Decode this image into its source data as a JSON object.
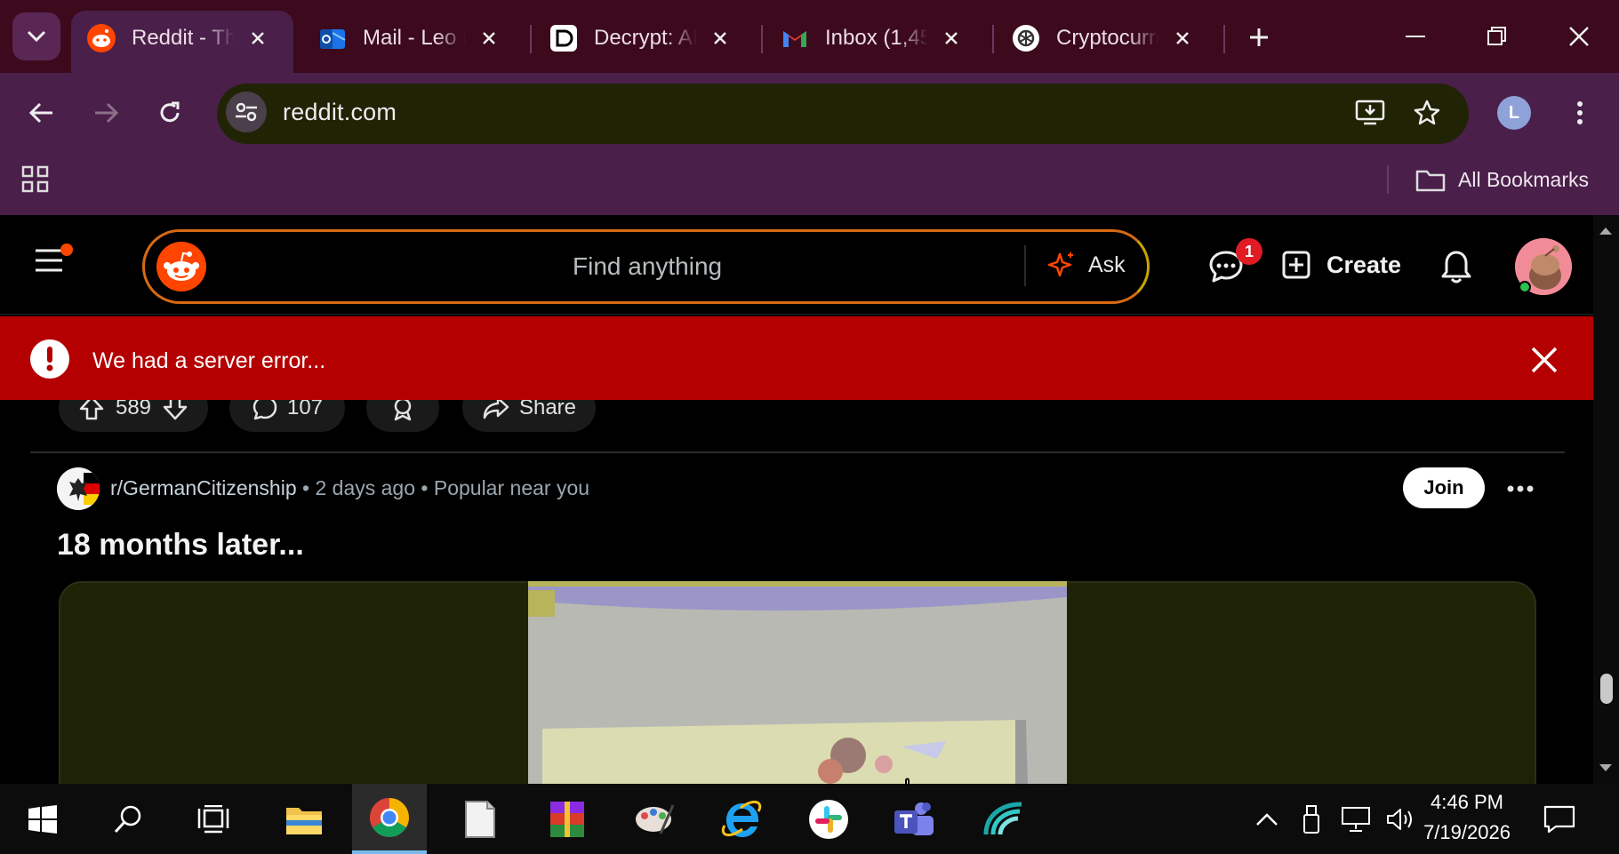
{
  "browser": {
    "tabs": [
      {
        "title": "Reddit - Th",
        "icon": "reddit-icon",
        "active": true
      },
      {
        "title": "Mail - Leo (",
        "icon": "outlook-icon",
        "active": false
      },
      {
        "title": "Decrypt: AI",
        "icon": "decrypt-icon",
        "active": false
      },
      {
        "title": "Inbox (1,45",
        "icon": "gmail-icon",
        "active": false
      },
      {
        "title": "Cryptocurre",
        "icon": "openai-icon",
        "active": false
      }
    ],
    "url": "reddit.com",
    "profile_initial": "L",
    "bookmarks_label": "All Bookmarks"
  },
  "reddit": {
    "search_placeholder": "Find anything",
    "ask_label": "Ask",
    "chat_badge": "1",
    "create_label": "Create",
    "error_message": "We had a server error...",
    "prev_post": {
      "votes": "589",
      "comments": "107",
      "share_label": "Share"
    },
    "post": {
      "subreddit": "r/GermanCitizenship",
      "age": "2 days ago",
      "tag": "Popular near you",
      "join_label": "Join",
      "title": "18 months later..."
    }
  },
  "taskbar": {
    "apps": [
      "start-icon",
      "search-icon",
      "task-view-icon",
      "file-explorer-icon",
      "chrome-icon",
      "notepad-icon",
      "winrar-icon",
      "paint-icon",
      "internet-explorer-icon",
      "slack-icon",
      "teams-icon",
      "app-icon"
    ],
    "time": "4:46 PM",
    "date": "7/19/2026"
  },
  "colors": {
    "tabstrip": "#3c0a1c",
    "toolbar": "#4a1f4a",
    "reddit_orange": "#ff4500",
    "error_red": "#b40000"
  }
}
